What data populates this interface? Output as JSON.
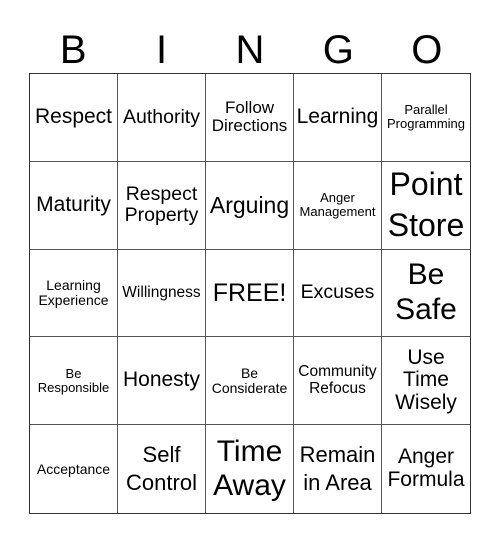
{
  "header": [
    "B",
    "I",
    "N",
    "G",
    "O"
  ],
  "cells": [
    "Respect",
    "Authority",
    "Follow Directions",
    "Learning",
    "Parallel Programming",
    "Maturity",
    "Respect Property",
    "Arguing",
    "Anger Management",
    "Point Store",
    "Learning Experience",
    "Willingness",
    "FREE!",
    "Excuses",
    "Be Safe",
    "Be Responsible",
    "Honesty",
    "Be Considerate",
    "Community Refocus",
    "Use Time Wisely",
    "Acceptance",
    "Self Control",
    "Time Away",
    "Remain in Area",
    "Anger Formula"
  ]
}
